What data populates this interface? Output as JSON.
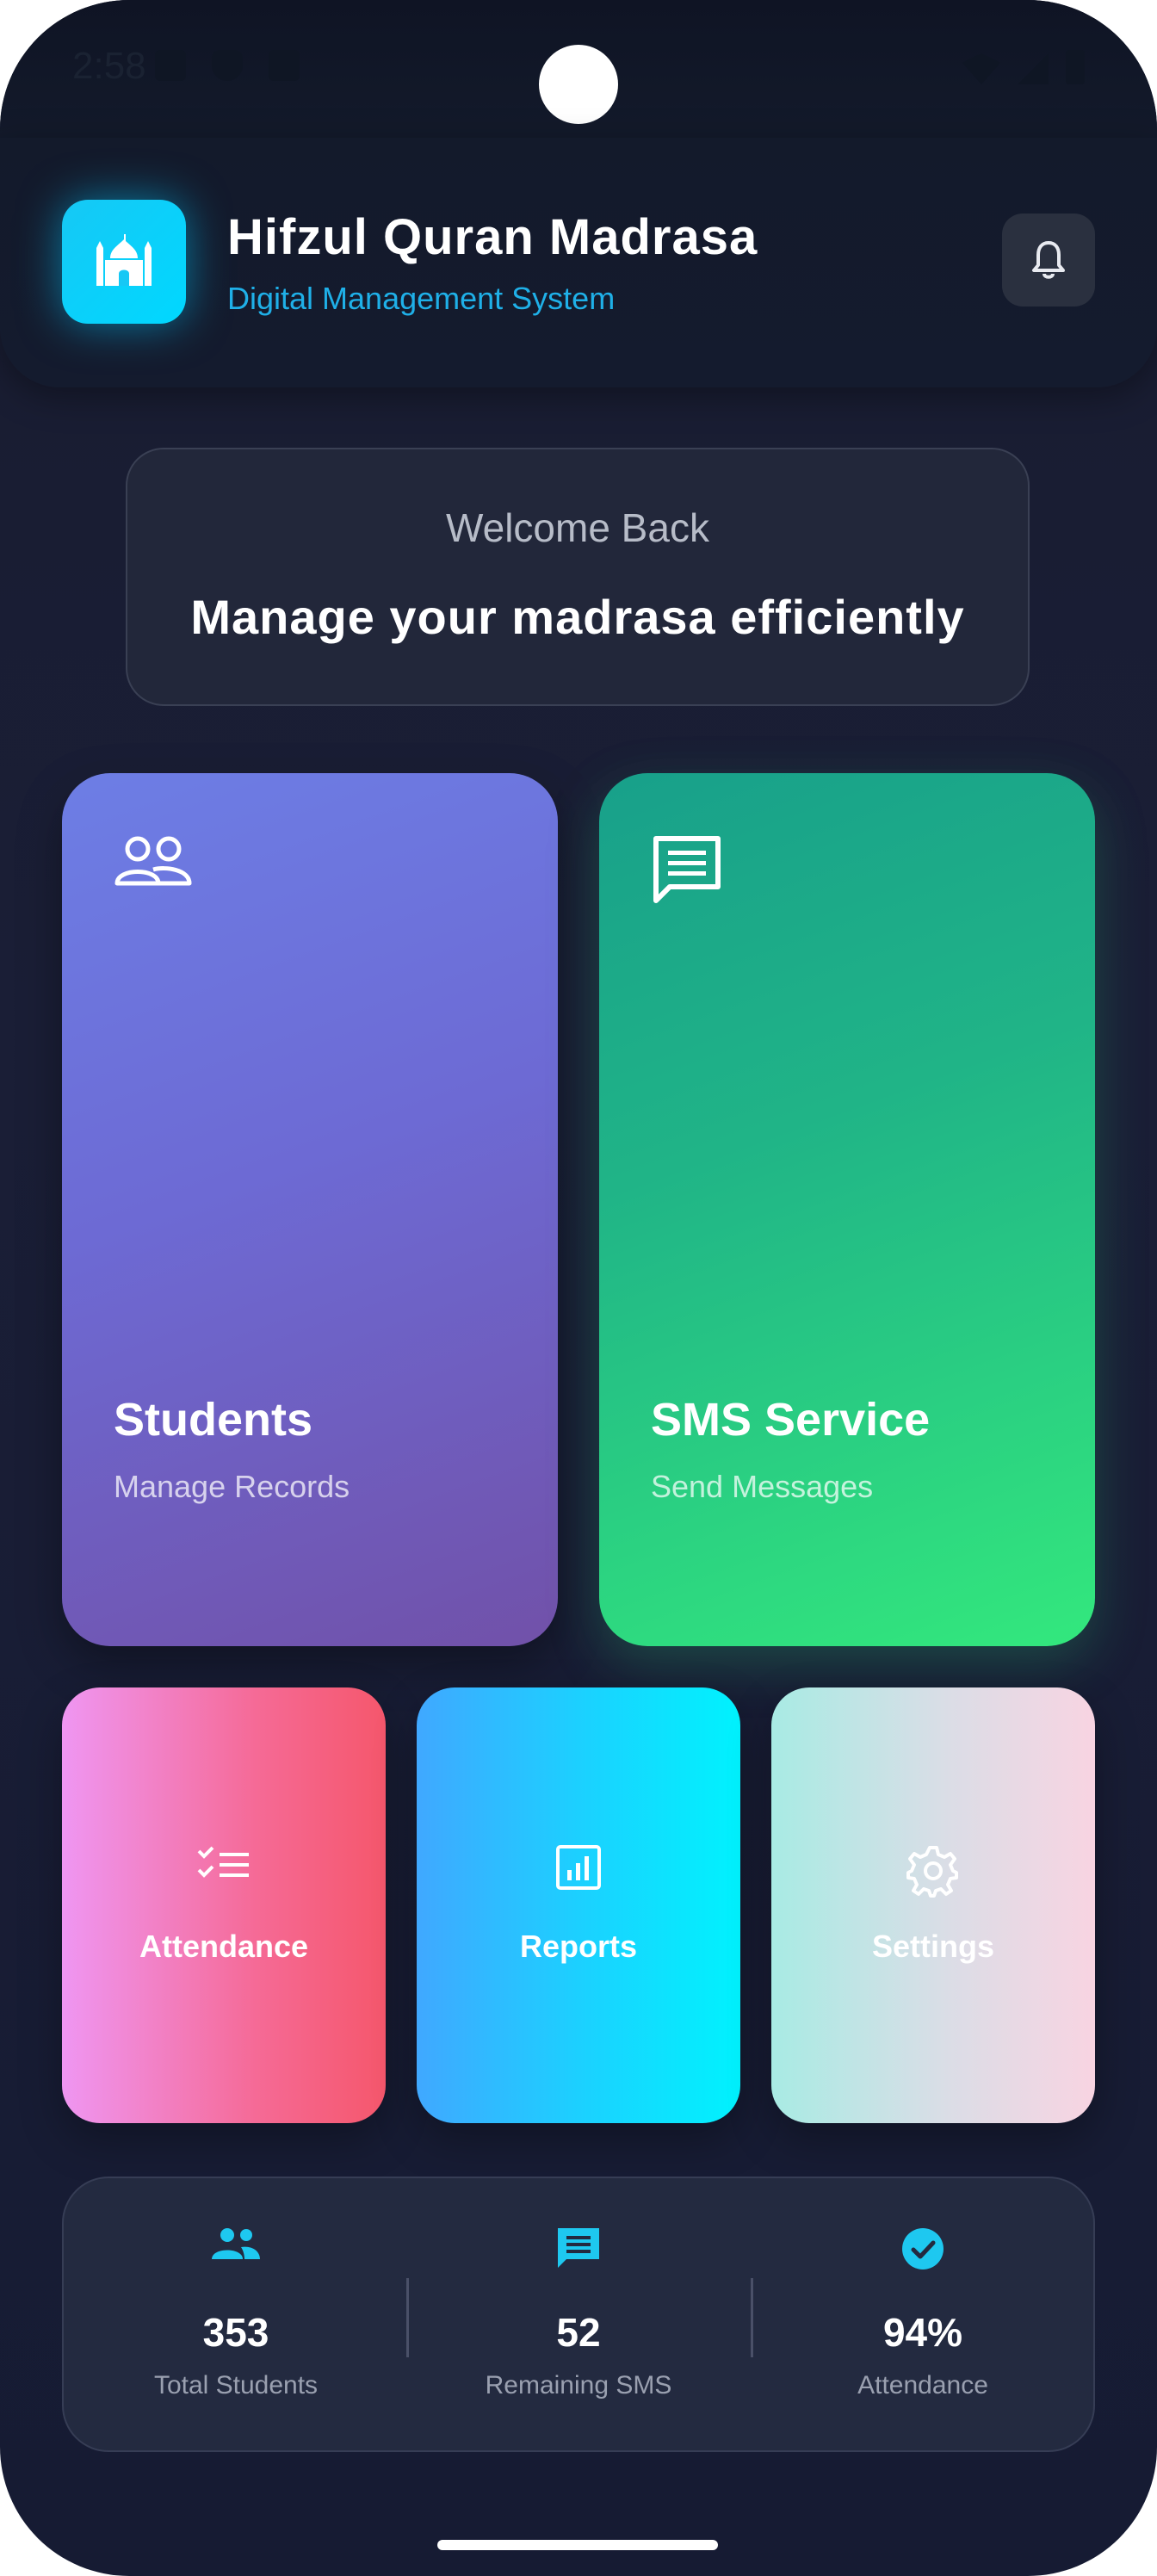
{
  "status_bar": {
    "time": "2:58",
    "icons_left": [
      "screen-icon",
      "shield-icon",
      "sd-card-icon"
    ],
    "icons_right": [
      "wifi-icon",
      "signal-icon",
      "battery-icon"
    ]
  },
  "header": {
    "logo_icon": "mosque-icon",
    "title": "Hifzul Quran Madrasa",
    "subtitle": "Digital Management System",
    "notification_icon": "bell-icon"
  },
  "welcome": {
    "greeting": "Welcome Back",
    "message": "Manage your madrasa efficiently"
  },
  "feature_cards": [
    {
      "icon": "people-icon",
      "title": "Students",
      "subtitle": "Manage Records"
    },
    {
      "icon": "message-icon",
      "title": "SMS Service",
      "subtitle": "Send Messages"
    }
  ],
  "quick_actions": [
    {
      "icon": "checklist-icon",
      "label": "Attendance"
    },
    {
      "icon": "report-chart-icon",
      "label": "Reports"
    },
    {
      "icon": "gear-icon",
      "label": "Settings"
    }
  ],
  "stats": [
    {
      "icon": "group-icon",
      "value": "353",
      "label": "Total Students"
    },
    {
      "icon": "chat-icon",
      "value": "52",
      "label": "Remaining SMS"
    },
    {
      "icon": "check-circle-icon",
      "value": "94%",
      "label": "Attendance"
    }
  ],
  "colors": {
    "accent": "#1fb0e8",
    "background": "#1a1e36",
    "stat_icon": "#1ec8f0"
  }
}
